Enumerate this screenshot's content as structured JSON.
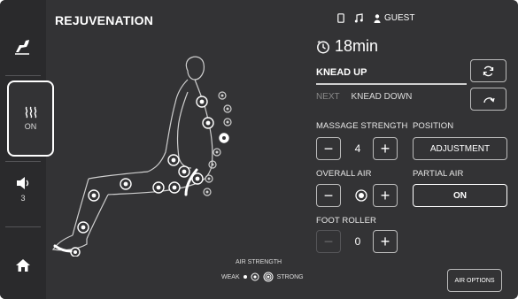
{
  "header": {
    "title": "REJUVENATION",
    "user": "GUEST"
  },
  "sidebar": {
    "heat_label": "ON",
    "volume_value": "3"
  },
  "timer": {
    "value": "18min"
  },
  "program": {
    "current": "KNEAD UP",
    "next_label": "NEXT",
    "next": "KNEAD DOWN"
  },
  "massage_strength": {
    "label": "MASSAGE STRENGTH",
    "minus": "−",
    "value": "4",
    "plus": "+"
  },
  "position": {
    "label": "POSITION",
    "button": "ADJUSTMENT"
  },
  "overall_air": {
    "label": "OVERALL AIR",
    "minus": "−",
    "plus": "+"
  },
  "partial_air": {
    "label": "PARTIAL AIR",
    "button": "ON"
  },
  "foot_roller": {
    "label": "FOOT ROLLER",
    "minus": "−",
    "value": "0",
    "plus": "+"
  },
  "air_strength": {
    "title": "AIR STRENGTH",
    "weak": "WEAK",
    "strong": "STRONG"
  },
  "air_options": {
    "label": "AIR OPTIONS"
  },
  "icons": {
    "chair": "recline-chair-icon",
    "heat": "heat-waves-icon",
    "volume": "speaker-icon",
    "home": "home-icon",
    "phone": "phone-icon",
    "music": "music-note-icon",
    "user": "user-icon",
    "timer": "timer-icon",
    "refresh": "refresh-icon",
    "skip": "skip-arrow-icon"
  },
  "colors": {
    "panel": "#333335",
    "sidebar": "#2a2a2c",
    "text": "#ffffff",
    "dim": "#888888"
  }
}
